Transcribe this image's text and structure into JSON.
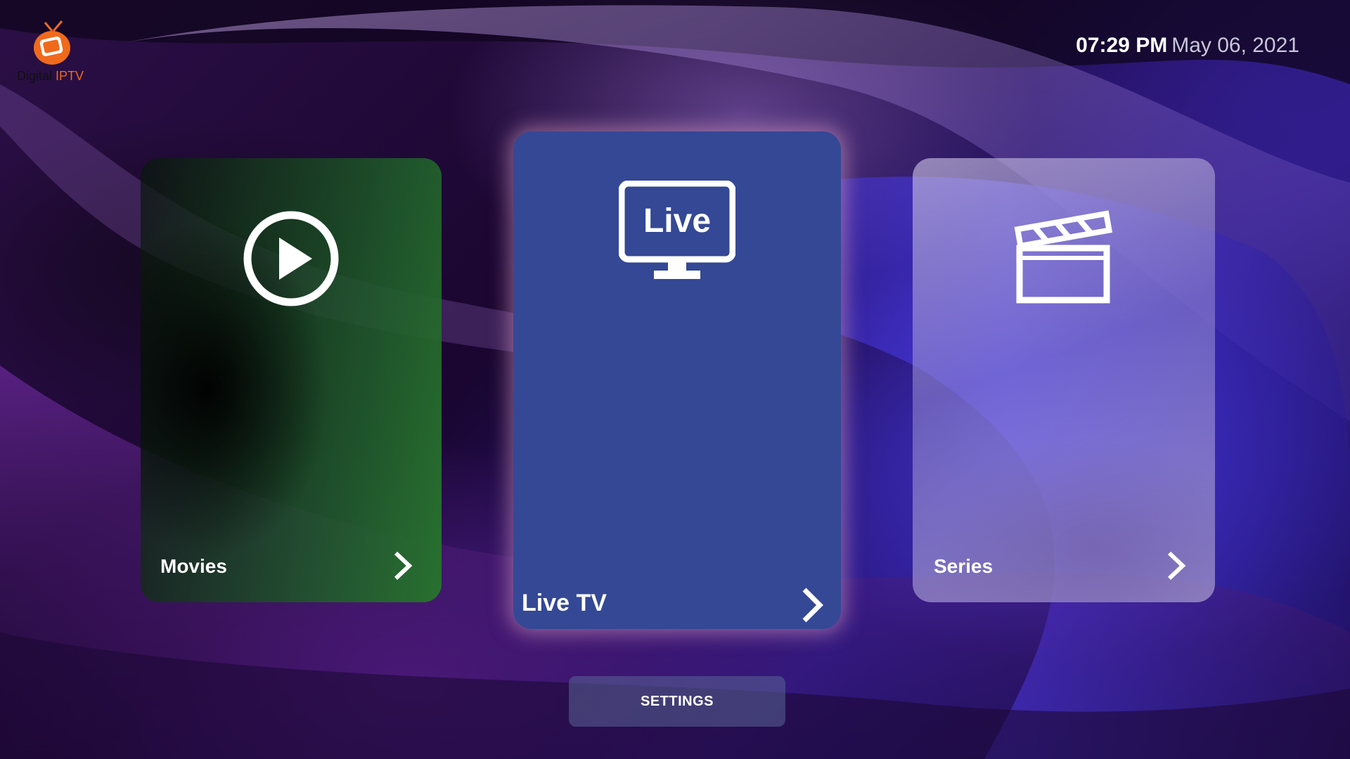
{
  "app": {
    "logo_text_primary": "Digital",
    "logo_text_accent": "IPTV",
    "logo_icon": "tv-icon"
  },
  "clock": {
    "time": "07:29 PM",
    "date": "May 06, 2021"
  },
  "cards": {
    "movies": {
      "label": "Movies",
      "icon": "play-circle-icon"
    },
    "live": {
      "label": "Live TV",
      "icon": "live-tv-icon",
      "icon_text": "Live"
    },
    "series": {
      "label": "Series",
      "icon": "clapperboard-icon"
    }
  },
  "settings": {
    "label": "SETTINGS"
  },
  "colors": {
    "accent_orange": "#f06a1c",
    "live_card": "#344895",
    "movies_card": "#28712f"
  }
}
